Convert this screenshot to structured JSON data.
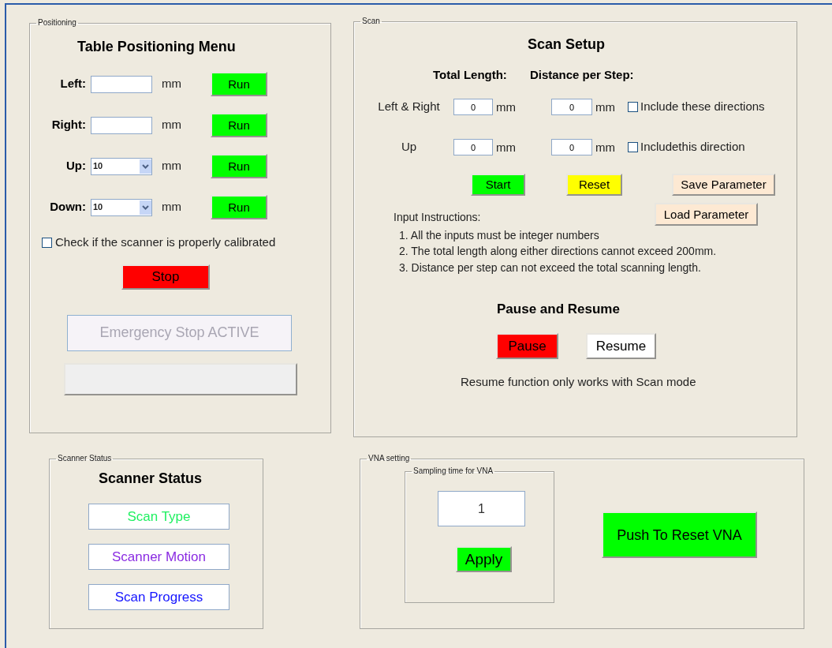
{
  "positioning": {
    "legend": "Positioning",
    "title": "Table Positioning Menu",
    "rows": [
      {
        "label": "Left:",
        "kind": "text",
        "unit": "mm",
        "button": "Run"
      },
      {
        "label": "Right:",
        "kind": "text",
        "unit": "mm",
        "button": "Run"
      },
      {
        "label": "Up:",
        "kind": "select",
        "value": "10",
        "unit": "mm",
        "button": "Run"
      },
      {
        "label": "Down:",
        "kind": "select",
        "value": "10",
        "unit": "mm",
        "button": "Run"
      }
    ],
    "calibration": {
      "label": "Check if the scanner is properly calibrated",
      "checked": false
    },
    "stop_button": "Stop",
    "emergency": {
      "label": "Emergency Stop ACTIVE",
      "disabled": true
    }
  },
  "scan": {
    "legend": "Scan",
    "title": "Scan Setup",
    "headers": [
      "Total Length:",
      "Distance per Step:"
    ],
    "rows": [
      {
        "label": "Left & Right",
        "total": "0",
        "total_unit": "mm",
        "step": "0",
        "step_unit": "mm",
        "include": {
          "label": "Include these directions",
          "checked": false
        }
      },
      {
        "label": "Up",
        "total": "0",
        "total_unit": "mm",
        "step": "0",
        "step_unit": "mm",
        "include": {
          "label": "Includethis direction",
          "checked": false
        }
      }
    ],
    "buttons": [
      {
        "label": "Start",
        "color": "#00ff00"
      },
      {
        "label": "Reset",
        "color": "#ffff00"
      },
      {
        "label": "Save Parameter",
        "color": "#fde9d3"
      }
    ],
    "load_button": {
      "label": "Load Parameter",
      "color": "#fde9d3"
    },
    "instructions_title": "Input Instructions:",
    "instructions": [
      "1. All the inputs must be integer numbers",
      "2. The total length along either directions cannot exceed 200mm.",
      "3. Distance per step can not exceed the total scanning length."
    ],
    "pause_title": "Pause and Resume",
    "pause_buttons": [
      {
        "label": "Pause",
        "color": "#ff0000"
      },
      {
        "label": "Resume",
        "color": "#ffffff"
      }
    ],
    "note": "Resume function only works with Scan mode"
  },
  "scanner_status": {
    "legend": "Scanner Status",
    "title": "Scanner Status",
    "items": [
      {
        "label": "Scan Type",
        "color": "#1ef060"
      },
      {
        "label": "Scanner Motion",
        "color": "#8a2be2"
      },
      {
        "label": "Scan Progress",
        "color": "#1414ff"
      }
    ]
  },
  "vna": {
    "legend": "VNA setting",
    "sampling": {
      "legend": "Sampling time for VNA",
      "value": "1",
      "button": "Apply"
    },
    "reset_button": "Push To Reset VNA"
  }
}
